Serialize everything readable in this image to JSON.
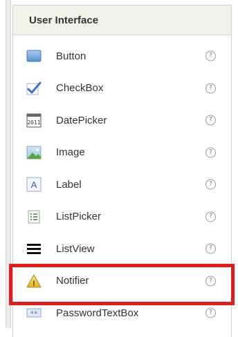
{
  "palette": {
    "title": "User Interface",
    "help_glyph": "?",
    "highlight_color": "#e21b1b",
    "items": [
      {
        "label": "Button",
        "icon": "button-icon"
      },
      {
        "label": "CheckBox",
        "icon": "checkbox-icon"
      },
      {
        "label": "DatePicker",
        "icon": "calendar-icon",
        "icon_text": "2011"
      },
      {
        "label": "Image",
        "icon": "image-icon"
      },
      {
        "label": "Label",
        "icon": "label-icon",
        "icon_text": "A"
      },
      {
        "label": "ListPicker",
        "icon": "list-picker-icon"
      },
      {
        "label": "ListView",
        "icon": "list-view-icon"
      },
      {
        "label": "Notifier",
        "icon": "warning-icon",
        "icon_text": "!"
      },
      {
        "label": "PasswordTextBox",
        "icon": "password-icon",
        "icon_text": "**"
      }
    ],
    "highlighted_item": "Notifier"
  }
}
